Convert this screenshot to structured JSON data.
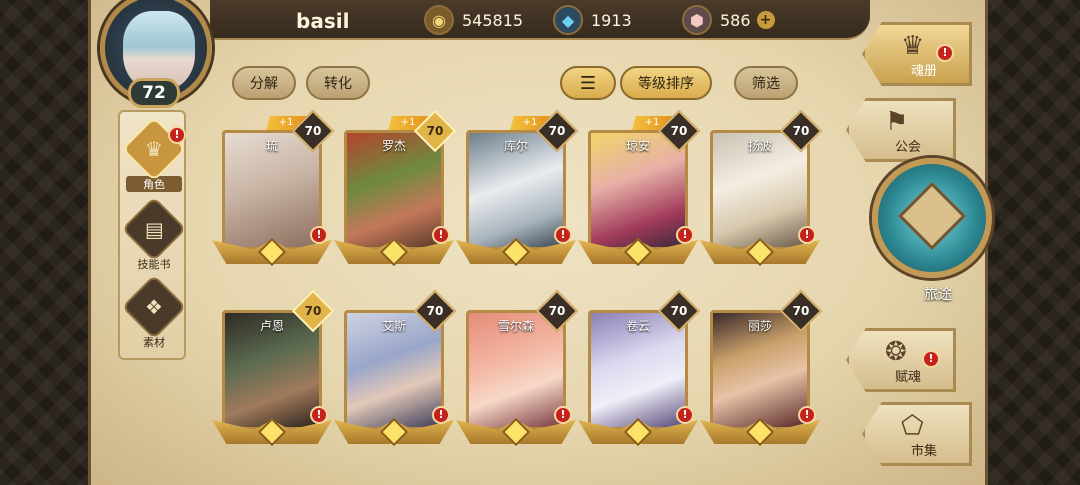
{
  "player": {
    "name": "basil",
    "level": "72"
  },
  "currencies": [
    {
      "icon": "gold-coin-icon",
      "value": "545815"
    },
    {
      "icon": "blue-crystal-icon",
      "value": "1913"
    },
    {
      "icon": "pink-gem-icon",
      "value": "586",
      "plus": "+"
    }
  ],
  "side_menu": [
    {
      "label": "角色",
      "icon": "character-icon",
      "alert": "!"
    },
    {
      "label": "技能书",
      "icon": "skill-book-icon"
    },
    {
      "label": "素材",
      "icon": "material-icon"
    }
  ],
  "actions": {
    "decompose": "分解",
    "convert": "转化",
    "sort_level": "等级排序",
    "filter": "筛选"
  },
  "characters": [
    {
      "name": "琉",
      "level": "70",
      "plus": "+1",
      "alert": "!",
      "gold_level": false
    },
    {
      "name": "罗杰",
      "level": "70",
      "plus": "+1",
      "alert": "!",
      "gold_level": true
    },
    {
      "name": "库尔",
      "level": "70",
      "plus": "+1",
      "alert": "!",
      "gold_level": false
    },
    {
      "name": "琼安",
      "level": "70",
      "plus": "+1",
      "alert": "!",
      "gold_level": false
    },
    {
      "name": "扬波",
      "level": "70",
      "plus": "",
      "alert": "!",
      "gold_level": false
    },
    {
      "name": "卢恩",
      "level": "70",
      "plus": "",
      "alert": "!",
      "gold_level": true
    },
    {
      "name": "艾斯",
      "level": "70",
      "plus": "",
      "alert": "!",
      "gold_level": false
    },
    {
      "name": "雪尔森",
      "level": "70",
      "plus": "",
      "alert": "!",
      "gold_level": false
    },
    {
      "name": "卷云",
      "level": "70",
      "plus": "",
      "alert": "!",
      "gold_level": false
    },
    {
      "name": "丽莎",
      "level": "70",
      "plus": "",
      "alert": "!",
      "gold_level": false
    }
  ],
  "right_nav": {
    "soul_book": {
      "label": "魂册",
      "alert": "!"
    },
    "guild": {
      "label": "公会"
    },
    "journey": {
      "label": "旅途"
    },
    "soul_gift": {
      "label": "赋魂",
      "alert": "!"
    },
    "market": {
      "label": "市集"
    }
  }
}
